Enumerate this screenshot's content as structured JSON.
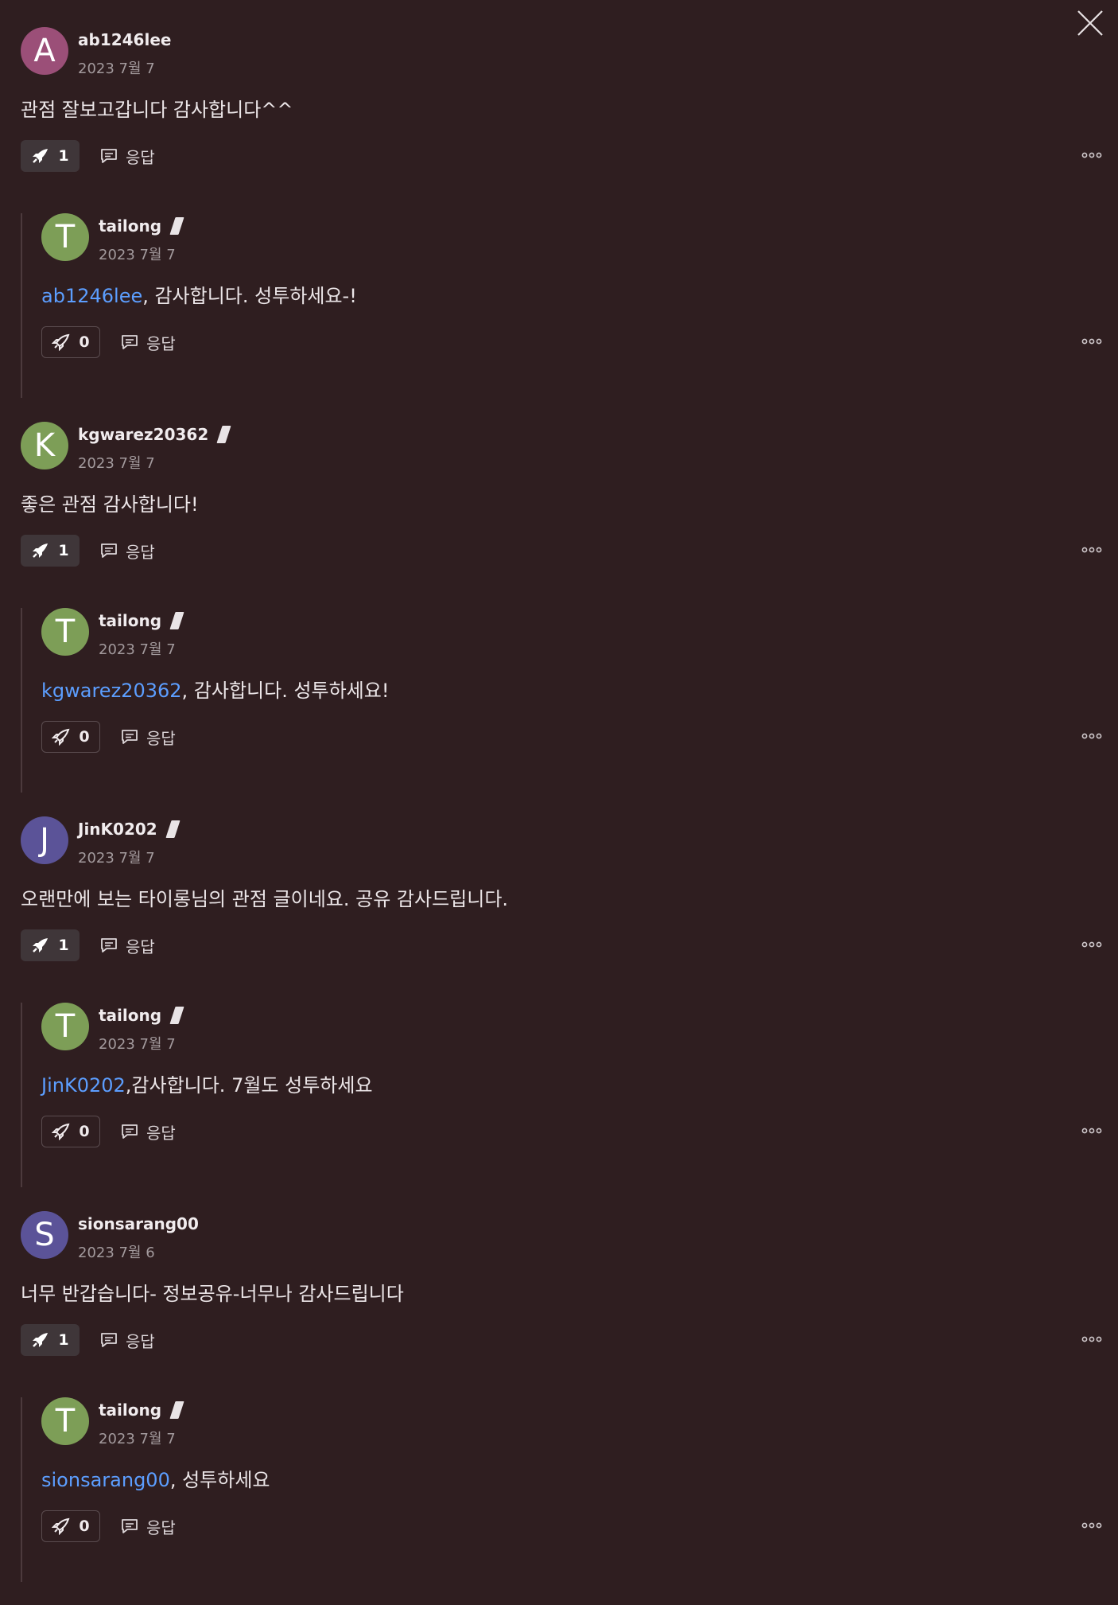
{
  "close_label": "",
  "threads": [
    {
      "comment": {
        "avatar_letter": "A",
        "avatar_color": "#9b4f78",
        "username": "ab1246lee",
        "editor_badge": false,
        "date": "2023 7월 7",
        "text": "관점 잘보고갑니다 감사합니다^^",
        "boosts": "1",
        "boost_active": true,
        "reply_label": "응답"
      },
      "reply": {
        "avatar_letter": "T",
        "avatar_color": "#7d9e57",
        "username": "tailong",
        "editor_badge": true,
        "date": "2023 7월 7",
        "mention": "ab1246lee",
        "text": ", 감사합니다. 성투하세요-!",
        "boosts": "0",
        "boost_active": false,
        "reply_label": "응답"
      }
    },
    {
      "comment": {
        "avatar_letter": "K",
        "avatar_color": "#7d9e57",
        "username": "kgwarez20362",
        "editor_badge": true,
        "date": "2023 7월 7",
        "text": "좋은 관점 감사합니다!",
        "boosts": "1",
        "boost_active": true,
        "reply_label": "응답"
      },
      "reply": {
        "avatar_letter": "T",
        "avatar_color": "#7d9e57",
        "username": "tailong",
        "editor_badge": true,
        "date": "2023 7월 7",
        "mention": "kgwarez20362",
        "text": ", 감사합니다. 성투하세요!",
        "boosts": "0",
        "boost_active": false,
        "reply_label": "응답"
      }
    },
    {
      "comment": {
        "avatar_letter": "J",
        "avatar_color": "#5b5398",
        "username": "JinK0202",
        "editor_badge": true,
        "date": "2023 7월 7",
        "text": "오랜만에 보는 타이롱님의 관점 글이네요. 공유 감사드립니다.",
        "boosts": "1",
        "boost_active": true,
        "reply_label": "응답"
      },
      "reply": {
        "avatar_letter": "T",
        "avatar_color": "#7d9e57",
        "username": "tailong",
        "editor_badge": true,
        "date": "2023 7월 7",
        "mention": "JinK0202",
        "text": ",감사합니다. 7월도 성투하세요",
        "boosts": "0",
        "boost_active": false,
        "reply_label": "응답"
      }
    },
    {
      "comment": {
        "avatar_letter": "S",
        "avatar_color": "#5b5398",
        "username": "sionsarang00",
        "editor_badge": false,
        "date": "2023 7월 6",
        "text": "너무 반갑습니다- 정보공유-너무나 감사드립니다",
        "boosts": "1",
        "boost_active": true,
        "reply_label": "응답"
      },
      "reply": {
        "avatar_letter": "T",
        "avatar_color": "#7d9e57",
        "username": "tailong",
        "editor_badge": true,
        "date": "2023 7월 7",
        "mention": "sionsarang00",
        "text": ", 성투하세요",
        "boosts": "0",
        "boost_active": false,
        "reply_label": "응답"
      }
    }
  ]
}
